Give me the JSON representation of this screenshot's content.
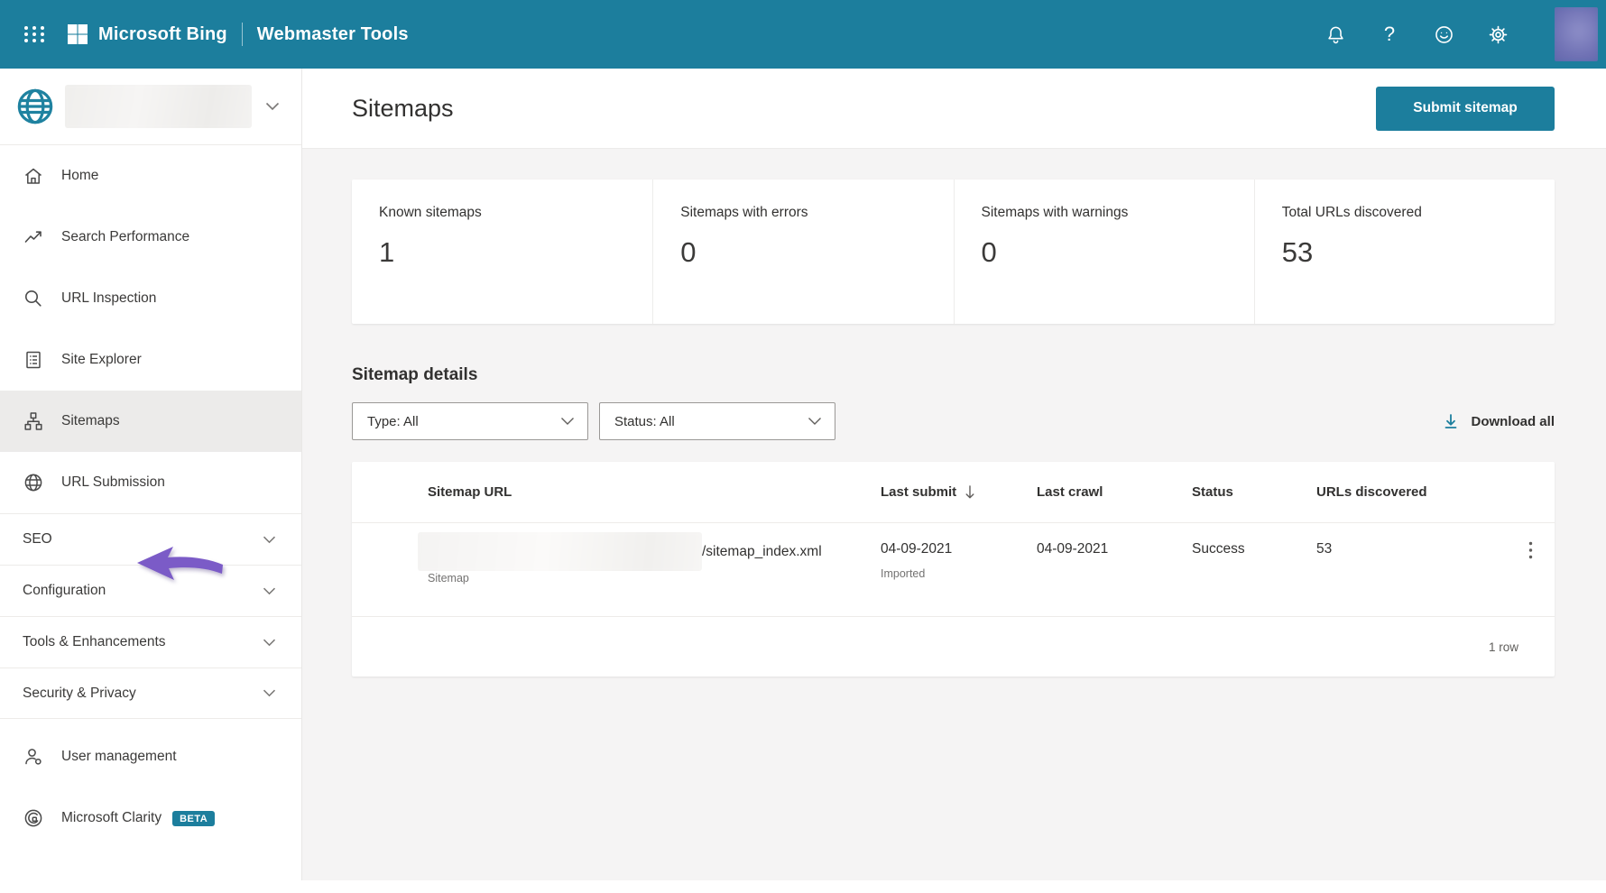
{
  "topbar": {
    "brand": "Microsoft Bing",
    "product": "Webmaster Tools"
  },
  "sidebar": {
    "items": [
      {
        "label": "Home",
        "icon": "home-icon"
      },
      {
        "label": "Search Performance",
        "icon": "trending-up-icon"
      },
      {
        "label": "URL Inspection",
        "icon": "magnifier-icon"
      },
      {
        "label": "Site Explorer",
        "icon": "document-list-icon"
      },
      {
        "label": "Sitemaps",
        "icon": "org-chart-icon",
        "selected": true
      },
      {
        "label": "URL Submission",
        "icon": "globe-icon"
      }
    ],
    "sections": [
      {
        "label": "SEO"
      },
      {
        "label": "Configuration"
      },
      {
        "label": "Tools & Enhancements"
      },
      {
        "label": "Security & Privacy"
      }
    ],
    "footer_items": [
      {
        "label": "User management",
        "icon": "person-icon"
      },
      {
        "label": "Microsoft Clarity",
        "icon": "clarity-icon",
        "badge": "BETA"
      }
    ]
  },
  "header": {
    "title": "Sitemaps",
    "submit_button": "Submit sitemap"
  },
  "stats": [
    {
      "label": "Known sitemaps",
      "value": "1"
    },
    {
      "label": "Sitemaps with errors",
      "value": "0"
    },
    {
      "label": "Sitemaps with warnings",
      "value": "0"
    },
    {
      "label": "Total URLs discovered",
      "value": "53"
    }
  ],
  "details": {
    "heading": "Sitemap details",
    "type_filter": "Type: All",
    "status_filter": "Status: All",
    "download_all": "Download all"
  },
  "table": {
    "columns": [
      "Sitemap URL",
      "Last submit",
      "Last crawl",
      "Status",
      "URLs discovered"
    ],
    "rows": [
      {
        "url_suffix": "/sitemap_index.xml",
        "type": "Sitemap",
        "last_submit": "04-09-2021",
        "last_submit_note": "Imported",
        "last_crawl": "04-09-2021",
        "status": "Success",
        "urls_discovered": "53"
      }
    ],
    "footer": "1 row"
  },
  "colors": {
    "topbar_teal": "#1C7E9D",
    "accent_teal": "#1C7E9D",
    "annotation_purple": "#7B5BC7",
    "main_background": "#F5F4F4"
  }
}
